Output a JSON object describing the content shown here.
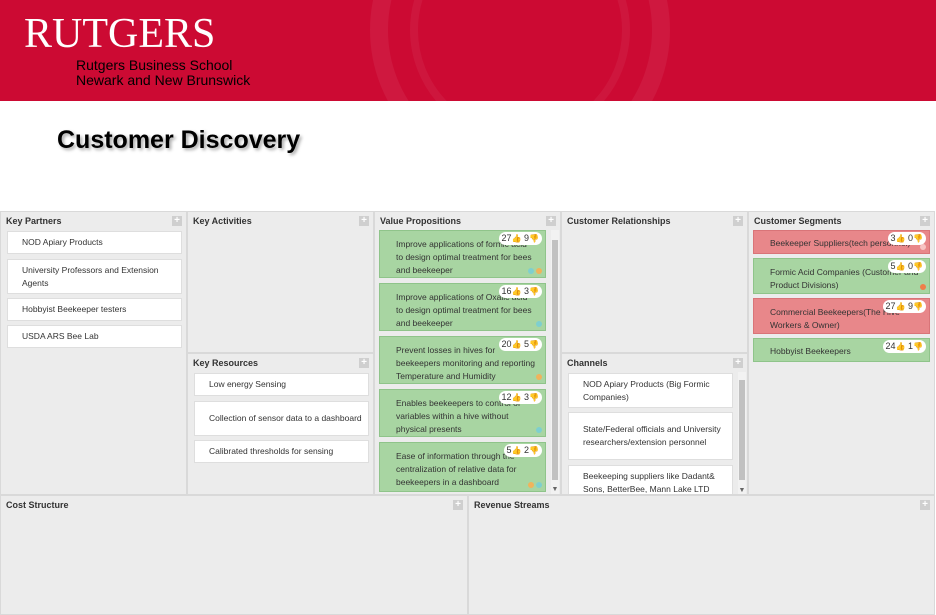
{
  "header": {
    "logo": "RUTGERS",
    "school_line1": "Rutgers Business School",
    "school_line2": "Newark and New Brunswick",
    "brand_color": "#cc0a33"
  },
  "page_title": "Customer Discovery",
  "canvas": {
    "key_partners": {
      "title": "Key Partners",
      "items": [
        "NOD Apiary Products",
        "University Professors and Extension Agents",
        "Hobbyist Beekeeper testers",
        "USDA ARS Bee Lab"
      ]
    },
    "key_activities": {
      "title": "Key Activities"
    },
    "key_resources": {
      "title": "Key Resources",
      "items": [
        "Low energy Sensing",
        "Collection of sensor data to a dashboard",
        "Calibrated thresholds for sensing"
      ]
    },
    "value_propositions": {
      "title": "Value Propositions",
      "items": [
        {
          "text": "Improve applications of formic acid to design optimal treatment for bees and beekeeper",
          "up": "27",
          "down": "9"
        },
        {
          "text": "Improve applications of Oxalic acid to design optimal treatment for bees and beekeeper",
          "up": "16",
          "down": "3"
        },
        {
          "text": "Prevent losses in hives for beekeepers monitoring and reporting Temperature and Humidity",
          "up": "20",
          "down": "5"
        },
        {
          "text": "Enables beekeepers to control of variables within a hive without physical presents",
          "up": "12",
          "down": "3"
        },
        {
          "text": "Ease of information through the centralization of relative data for beekeepers in a dashboard",
          "up": "5",
          "down": "2"
        }
      ]
    },
    "customer_relationships": {
      "title": "Customer Relationships"
    },
    "channels": {
      "title": "Channels",
      "items": [
        "NOD Apiary Products (Big Formic Companies)",
        "State/Federal officials and University researchers/extension personnel",
        "Beekeeping suppliers like Dadant& Sons, BetterBee, Mann Lake LTD"
      ]
    },
    "customer_segments": {
      "title": "Customer Segments",
      "items": [
        {
          "text": "Beekeeper Suppliers(tech personnel)",
          "up": "3",
          "down": "0"
        },
        {
          "text": "Formic Acid Companies (Customer and Product Divisions)",
          "up": "5",
          "down": "0"
        },
        {
          "text": "Commercial Beekeepers(The Hive Workers & Owner)",
          "up": "27",
          "down": "9"
        },
        {
          "text": "Hobbyist Beekeepers",
          "up": "24",
          "down": "1"
        }
      ]
    },
    "cost_structure": {
      "title": "Cost Structure"
    },
    "revenue_streams": {
      "title": "Revenue Streams"
    },
    "add_label": "+",
    "thumb_up_icon": "👍",
    "thumb_down_icon": "👎"
  }
}
